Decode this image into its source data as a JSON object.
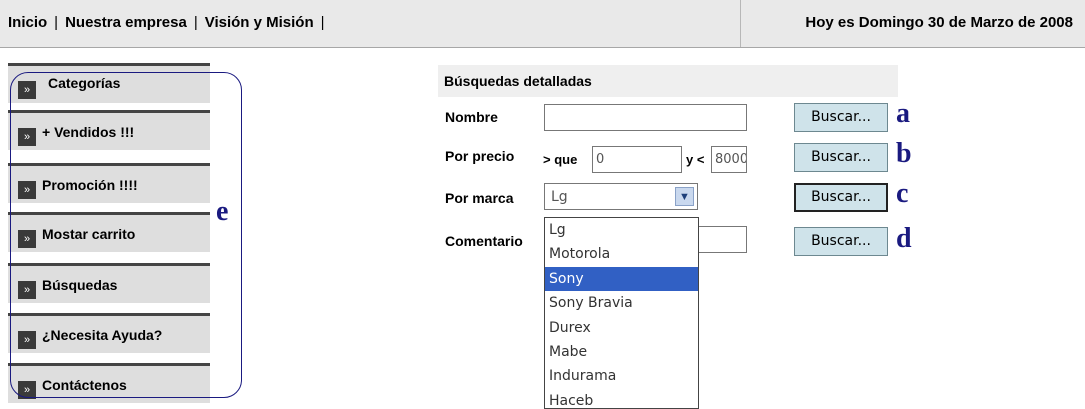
{
  "nav": {
    "items": [
      "Inicio",
      "Nuestra empresa",
      "Visión y Misión"
    ],
    "separator": "|"
  },
  "header": {
    "date": "Hoy es Domingo 30 de Marzo de 2008"
  },
  "sidebar": {
    "bullet": "»",
    "items": [
      "Categorías",
      "+ Vendidos !!!",
      "Promoción !!!!",
      "Mostar carrito",
      "Búsquedas",
      "¿Necesita Ayuda?",
      "Contáctenos"
    ]
  },
  "search": {
    "title": "Búsquedas detalladas",
    "nombre_label": "Nombre",
    "nombre_value": "",
    "precio_label": "Por precio",
    "precio_que": "> que",
    "precio_min": "0",
    "precio_y": "y <",
    "precio_max": "8000",
    "marca_label": "Por marca",
    "marca_value": "Lg",
    "comentario_label": "Comentario",
    "comentario_value": "",
    "button_label": "Buscar...",
    "brand_options": [
      "Lg",
      "Motorola",
      "Sony",
      "Sony Bravia",
      "Durex",
      "Mabe",
      "Indurama",
      "Haceb"
    ],
    "highlighted_option": "Sony"
  },
  "annotations": {
    "a": "a",
    "b": "b",
    "c": "c",
    "d": "d",
    "e": "e"
  },
  "colors": {
    "annotation": "#1a1a80",
    "button_bg": "#cfe3ea",
    "selected_option": "#3160c4"
  },
  "icons": {
    "dropdown_arrow": "chevron-down-icon"
  }
}
